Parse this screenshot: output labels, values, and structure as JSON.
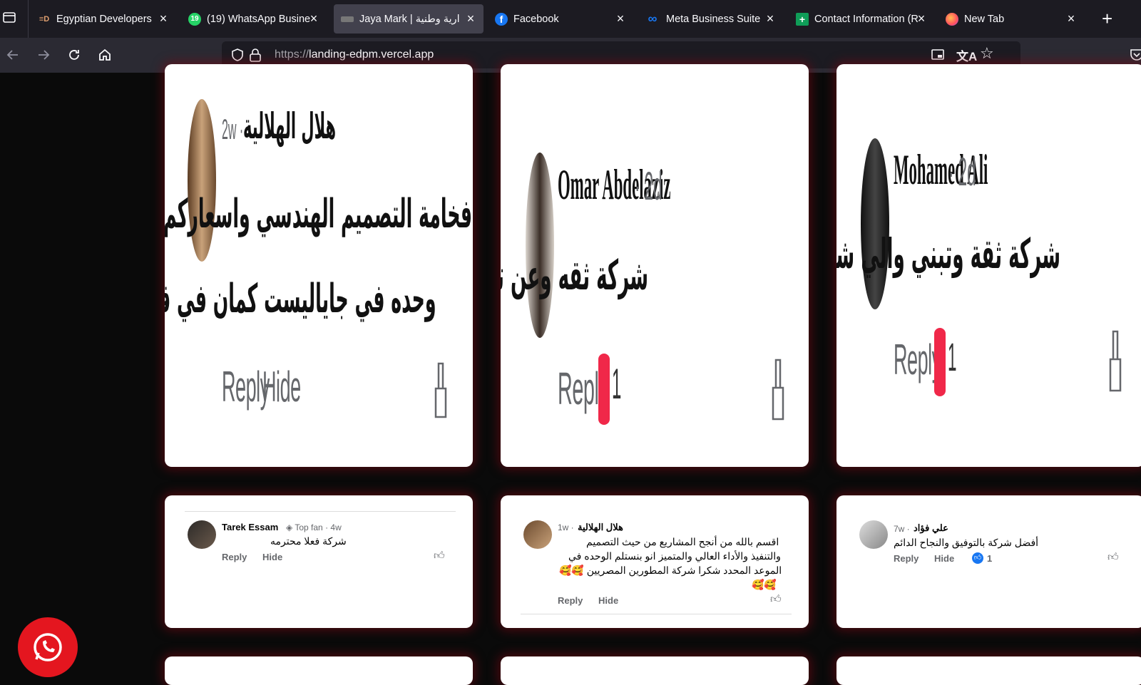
{
  "tabs": [
    {
      "title": "Egyptian Developers",
      "icon": "ed-logo-icon",
      "active": false
    },
    {
      "title": "(19) WhatsApp Busine",
      "icon": "whatsapp-icon",
      "badge": "19",
      "active": false
    },
    {
      "title": "Jaya Mark | ارية وطنية",
      "icon": "jaya-mark-icon",
      "active": true
    },
    {
      "title": "Facebook",
      "icon": "facebook-icon",
      "active": false
    },
    {
      "title": "Meta Business Suite",
      "icon": "meta-icon",
      "active": false
    },
    {
      "title": "Contact Information (R",
      "icon": "sheets-icon",
      "active": false
    },
    {
      "title": "New Tab",
      "icon": "firefox-icon",
      "active": false
    }
  ],
  "url": {
    "protocol": "https://",
    "host": "landing-edpm.vercel.app"
  },
  "reviews_large": [
    {
      "name": "هلال الهلالية",
      "time": "2w ·",
      "text_line1": "فخامة التصميم الهندسي واسعاركم في المتناول انا ليا",
      "text_line2": "وحده في جاياليست كمان في قمة الفخااااااامه",
      "reply": "Reply",
      "hide": "Hide"
    },
    {
      "name": "Omar Abdelaziz",
      "time": "· 2d",
      "text_line1": "شركة ثقه وعن تجربه",
      "reply": "Reply",
      "reactions": "1"
    },
    {
      "name": "Mohamed Ali",
      "time": "· 2d",
      "text_line1": "شركة ثقة وتبني والي شاري معاها كسبان",
      "reply": "Reply",
      "reactions": "1"
    }
  ],
  "reviews_small": [
    {
      "name": "Tarek Essam",
      "badge": "Top fan",
      "time": "· 4w",
      "text": "شركة فعلا محترمه",
      "reply": "Reply",
      "hide": "Hide"
    },
    {
      "name": "هلال الهلالية",
      "time": "1w ·",
      "text_lines": [
        "اقسم بالله من أنجح المشاريع من حيث التصميم",
        "والتنفيذ والأداء العالي والمتميز انو بنستلم الوحده في",
        "الموعد المحدد شكرا شركة المطورين المصريين 🥰🥰",
        "🥰🥰"
      ],
      "reply": "Reply",
      "hide": "Hide"
    },
    {
      "name": "علي فؤاد",
      "time": "7w ·",
      "text": "أفضل شركة بالتوفيق والنجاح الدائم",
      "reply": "Reply",
      "hide": "Hide",
      "reactions": "1"
    }
  ],
  "colors": {
    "accent": "#e4161f",
    "tab_bg": "#1c1b22",
    "page_bg": "#0a0a0a",
    "card_glow": "#780a14"
  }
}
